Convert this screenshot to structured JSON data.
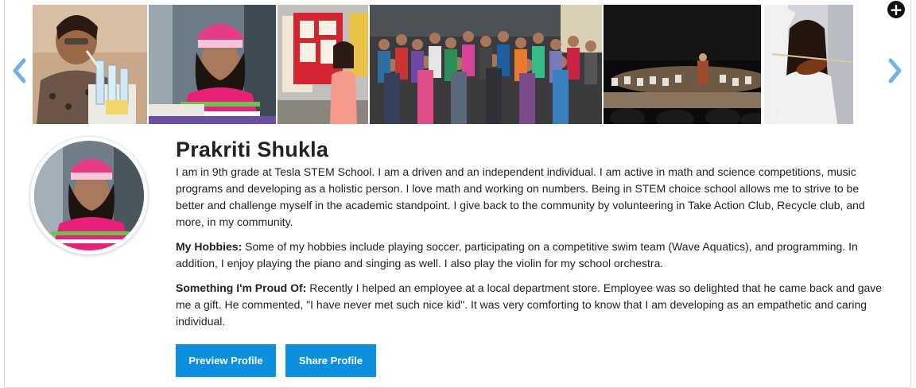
{
  "gallery": {
    "photos": [
      {
        "icon": "photo-lab-experiment"
      },
      {
        "icon": "photo-pink-beanie"
      },
      {
        "icon": "photo-science-fair"
      },
      {
        "icon": "photo-group"
      },
      {
        "icon": "photo-orchestra-stage"
      },
      {
        "icon": "photo-violin"
      }
    ],
    "prev_icon": "chevron-left-icon",
    "next_icon": "chevron-right-icon",
    "add_icon": "plus-circle-icon"
  },
  "profile": {
    "name": "Prakriti Shukla",
    "bio": "I am in 9th grade at Tesla STEM School. I am a driven and an independent individual. I am active in math and science competitions, music programs and developing as a holistic person. I love math and working on numbers. Being in STEM choice school allows me to strive to be better and challenge myself in the academic standpoint. I give back to the community by volunteering in Take Action Club, Recycle club, and more, in my community.",
    "hobbies_label": "My Hobbies:",
    "hobbies_text": " Some of my hobbies include playing soccer, participating on a competitive swim team (Wave Aquatics), and programming. In addition, I enjoy playing the piano and singing as well. I also play the violin for my school orchestra.",
    "proud_label": "Something I'm Proud Of:",
    "proud_text": " Recently I helped an employee at a local department store. Employee was so delighted that he came back and gave me a gift. He commented, \"I have never met such nice kid\". It was very comforting to know that I am developing as an empathetic and caring individual."
  },
  "actions": {
    "preview_label": "Preview Profile",
    "share_label": "Share Profile"
  },
  "colors": {
    "accent": "#0d8fe0",
    "arrow": "#6fb2e6"
  }
}
